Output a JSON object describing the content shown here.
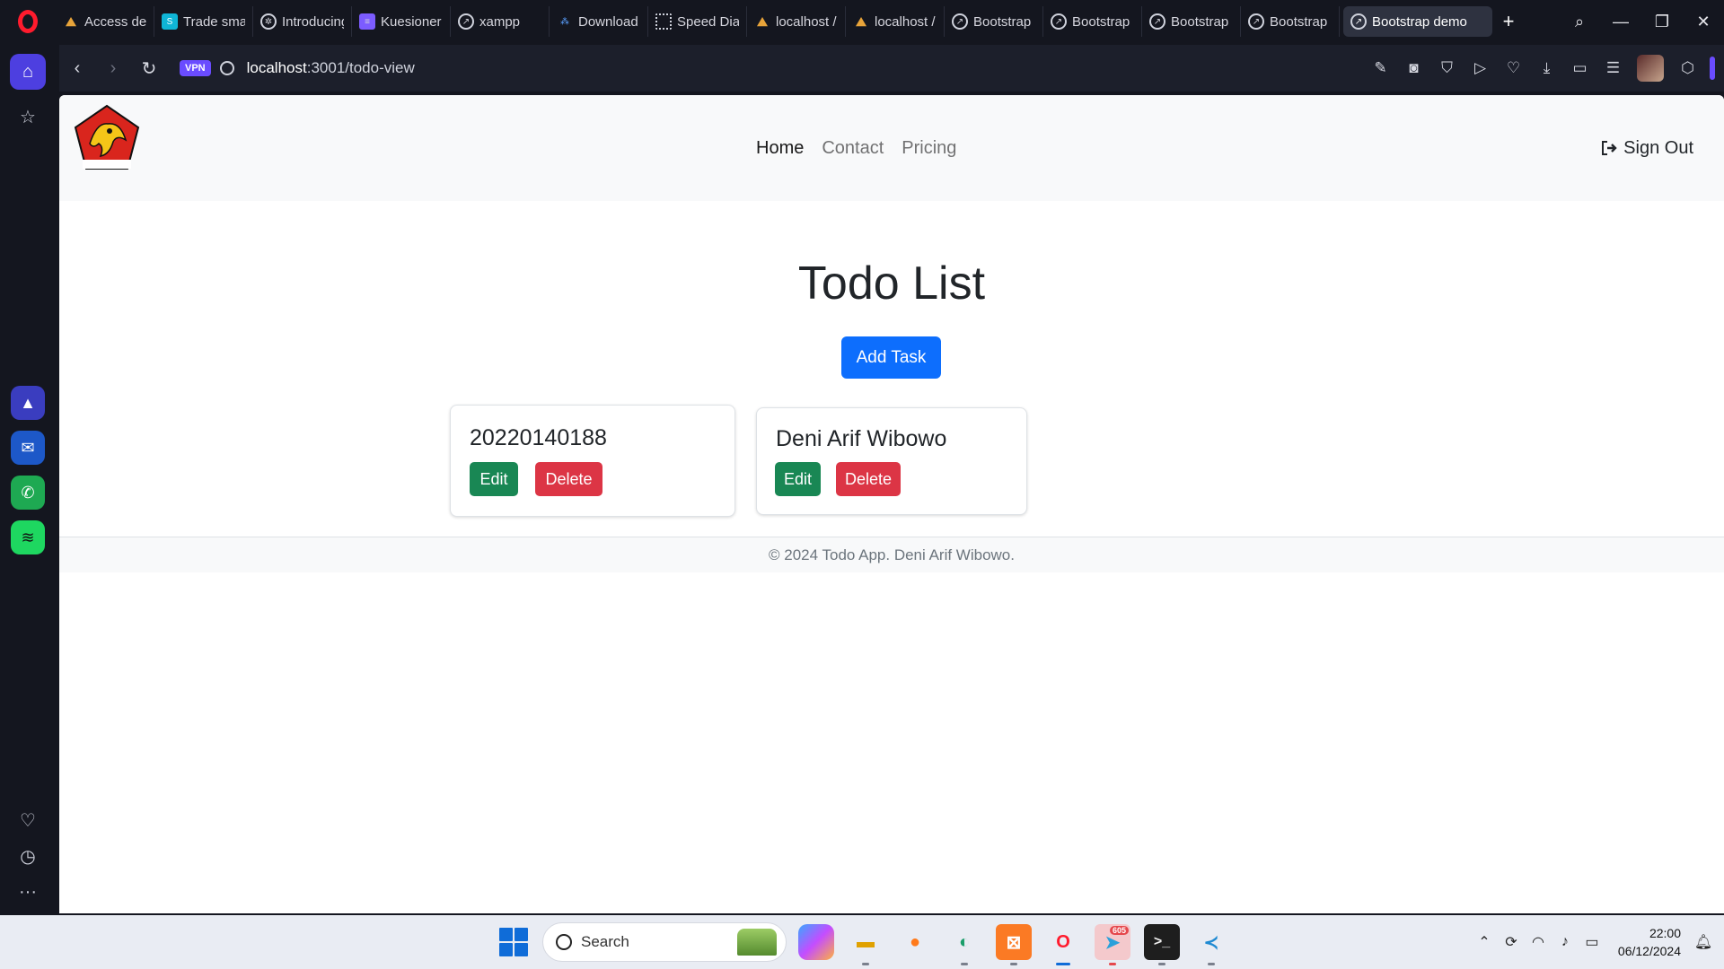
{
  "browser": {
    "tabs": [
      {
        "label": "Access den",
        "icon": "phpmyadmin-icon"
      },
      {
        "label": "Trade smar",
        "icon": "tradingview-icon"
      },
      {
        "label": "Introducing",
        "icon": "openai-icon"
      },
      {
        "label": "Kuesioner",
        "icon": "forms-icon"
      },
      {
        "label": "xampp",
        "icon": "globe-icon"
      },
      {
        "label": "Download",
        "icon": "download-icon"
      },
      {
        "label": "Speed Dial",
        "icon": "speed-dial-icon"
      },
      {
        "label": "localhost /",
        "icon": "phpmyadmin-icon"
      },
      {
        "label": "localhost /",
        "icon": "phpmyadmin-icon"
      },
      {
        "label": "Bootstrap",
        "icon": "globe-icon"
      },
      {
        "label": "Bootstrap",
        "icon": "globe-icon"
      },
      {
        "label": "Bootstrap",
        "icon": "globe-icon"
      },
      {
        "label": "Bootstrap",
        "icon": "globe-icon"
      }
    ],
    "active_tab": {
      "label": "Bootstrap demo",
      "icon": "globe-icon"
    },
    "vpn_label": "VPN",
    "url_host": "localhost",
    "url_path": ":3001/todo-view",
    "accent": "#6a4cff"
  },
  "page": {
    "nav": {
      "home": "Home",
      "contact": "Contact",
      "pricing": "Pricing",
      "signout": "Sign Out",
      "brand_text": "GERINDRA"
    },
    "title": "Todo List",
    "add_button": "Add Task",
    "tasks": [
      {
        "title": "20220140188",
        "edit": "Edit",
        "delete": "Delete"
      },
      {
        "title": "Deni Arif Wibowo",
        "edit": "Edit",
        "delete": "Delete"
      }
    ],
    "footer": "© 2024 Todo App. Deni Arif Wibowo.",
    "colors": {
      "primary": "#0d6efd",
      "success": "#198754",
      "danger": "#dc3545"
    }
  },
  "taskbar": {
    "search_placeholder": "Search",
    "time": "22:00",
    "date": "06/12/2024",
    "telegram_badge": "605"
  }
}
